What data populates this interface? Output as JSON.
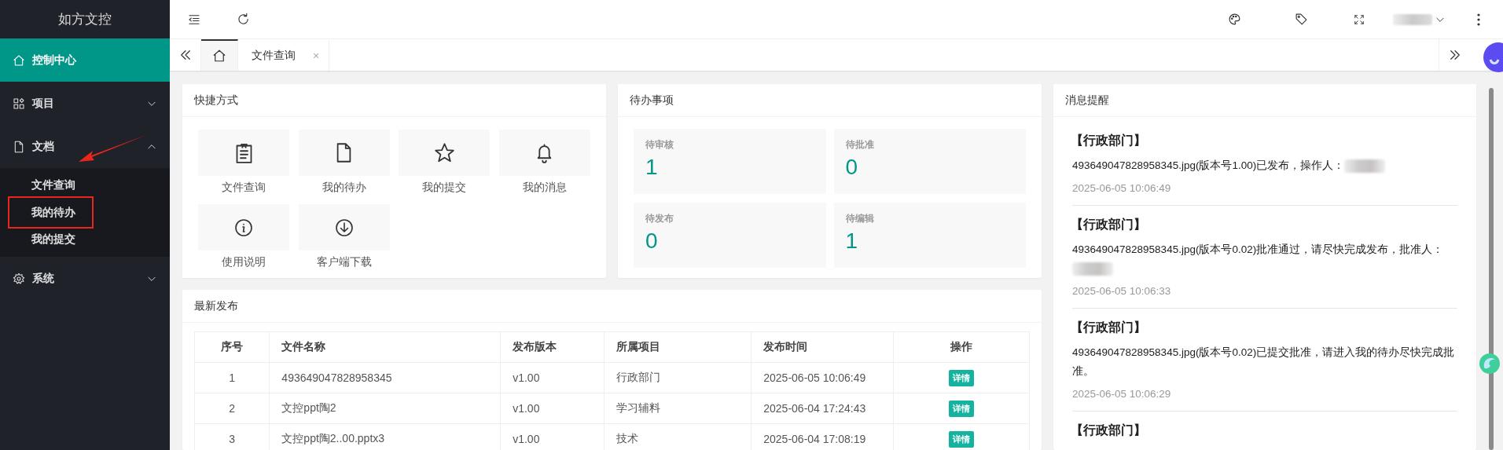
{
  "sidebar": {
    "logo": "如方文控",
    "menu": [
      {
        "label": "控制中心",
        "selected": true
      },
      {
        "label": "项目",
        "selected": false,
        "expanded": false
      },
      {
        "label": "文档",
        "selected": false,
        "expanded": true,
        "annotated": true,
        "children": [
          {
            "label": "文件查询",
            "highlighted": false
          },
          {
            "label": "我的待办",
            "highlighted": true
          },
          {
            "label": "我的提交",
            "highlighted": false
          }
        ]
      },
      {
        "label": "系统",
        "selected": false,
        "expanded": false
      }
    ]
  },
  "tabs": [
    {
      "kind": "home",
      "selected": true
    },
    {
      "kind": "page",
      "label": "文件查询",
      "close": "×",
      "selected": false
    }
  ],
  "shortcuts": {
    "title": "快捷方式",
    "items": [
      {
        "label": "文件查询"
      },
      {
        "label": "我的待办"
      },
      {
        "label": "我的提交"
      },
      {
        "label": "我的消息"
      },
      {
        "label": "使用说明"
      },
      {
        "label": "客户端下载"
      }
    ]
  },
  "todo": {
    "title": "待办事项",
    "items": [
      {
        "label": "待审核",
        "count": "1"
      },
      {
        "label": "待批准",
        "count": "0"
      },
      {
        "label": "待发布",
        "count": "0"
      },
      {
        "label": "待编辑",
        "count": "1"
      }
    ]
  },
  "messages": {
    "title": "消息提醒",
    "items": [
      {
        "title": "【行政部门】",
        "text": "493649047828958345.jpg(版本号1.00)已发布，操作人：",
        "redacted": true,
        "time": "2025-06-05 10:06:49"
      },
      {
        "title": "【行政部门】",
        "text": "493649047828958345.jpg(版本号0.02)批准通过，请尽快完成发布，批准人：",
        "redacted": true,
        "time": "2025-06-05 10:06:33"
      },
      {
        "title": "【行政部门】",
        "text": "493649047828958345.jpg(版本号0.02)已提交批准，请进入我的待办尽快完成批准。",
        "redacted": false,
        "time": "2025-06-05 10:06:29"
      },
      {
        "title": "【行政部门】"
      }
    ]
  },
  "latest": {
    "title": "最新发布",
    "columns": [
      "序号",
      "文件名称",
      "发布版本",
      "所属项目",
      "发布时间",
      "操作"
    ],
    "rows": [
      {
        "cells": [
          "1",
          "493649047828958345",
          "v1.00",
          "行政部门",
          "2025-06-05 10:06:49"
        ],
        "action": "详情"
      },
      {
        "cells": [
          "2",
          "文控ppt陶2",
          "v1.00",
          "学习辅料",
          "2025-06-04 17:24:43"
        ],
        "action": "详情"
      },
      {
        "cells": [
          "3",
          "文控ppt陶2..00.pptx3",
          "v1.00",
          "技术",
          "2025-06-04 17:08:19"
        ],
        "action": "详情"
      }
    ]
  }
}
